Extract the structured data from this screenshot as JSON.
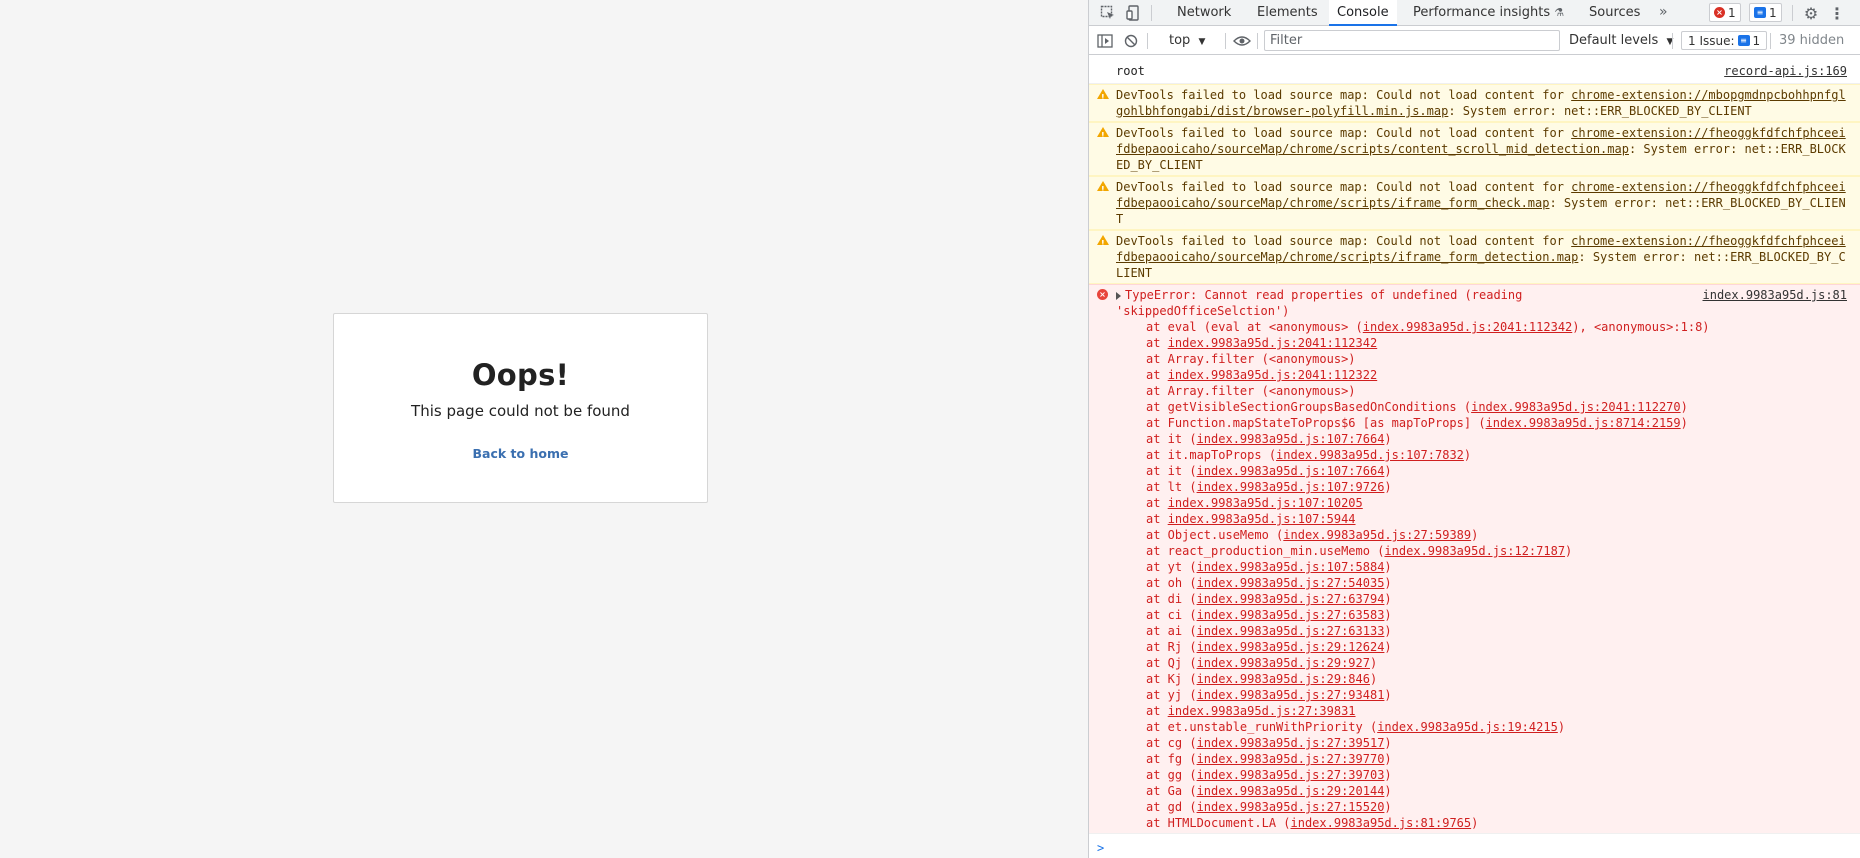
{
  "page": {
    "title": "Oops!",
    "subtitle": "This page could not be found",
    "back_link": "Back to home"
  },
  "devtools": {
    "tabs": [
      "Network",
      "Elements",
      "Console",
      "Performance insights",
      "Sources"
    ],
    "active_tab": "Console",
    "more_tabs_glyph": "»",
    "error_count": "1",
    "message_count": "1",
    "toolbar": {
      "context": "top",
      "filter_placeholder": "Filter",
      "levels": "Default levels",
      "issues_label": "1 Issue:",
      "issues_count": "1",
      "hidden": "39 hidden"
    },
    "log": {
      "text": "root",
      "source": "record-api.js:169"
    },
    "warnings": [
      {
        "prefix": "DevTools failed to load source map: Could not load content for ",
        "url": "chrome-extension://mbopgmdnpcbohhpnfglgohlbhfongabi/dist/browser-polyfill.min.js.map",
        "suffix": ": System error: net::ERR_BLOCKED_BY_CLIENT"
      },
      {
        "prefix": "DevTools failed to load source map: Could not load content for ",
        "url": "chrome-extension://fheoggkfdfchfphceeifdbepaooicaho/sourceMap/chrome/scripts/content_scroll_mid_detection.map",
        "suffix": ": System error: net::ERR_BLOCKED_BY_CLIENT"
      },
      {
        "prefix": "DevTools failed to load source map: Could not load content for ",
        "url": "chrome-extension://fheoggkfdfchfphceeifdbepaooicaho/sourceMap/chrome/scripts/iframe_form_check.map",
        "suffix": ": System error: net::ERR_BLOCKED_BY_CLIENT"
      },
      {
        "prefix": "DevTools failed to load source map: Could not load content for ",
        "url": "chrome-extension://fheoggkfdfchfphceeifdbepaooicaho/sourceMap/chrome/scripts/iframe_form_detection.map",
        "suffix": ": System error: net::ERR_BLOCKED_BY_CLIENT"
      }
    ],
    "error": {
      "message": "TypeError: Cannot read properties of undefined (reading 'skippedOfficeSelction')",
      "source": "index.9983a95d.js:81",
      "stack": [
        {
          "pre": "at eval (eval at <anonymous> (",
          "link": "index.9983a95d.js:2041:112342",
          "post": "), <anonymous>:1:8)"
        },
        {
          "pre": "at ",
          "link": "index.9983a95d.js:2041:112342",
          "post": ""
        },
        {
          "pre": "at Array.filter (<anonymous>)",
          "link": "",
          "post": ""
        },
        {
          "pre": "at ",
          "link": "index.9983a95d.js:2041:112322",
          "post": ""
        },
        {
          "pre": "at Array.filter (<anonymous>)",
          "link": "",
          "post": ""
        },
        {
          "pre": "at getVisibleSectionGroupsBasedOnConditions (",
          "link": "index.9983a95d.js:2041:112270",
          "post": ")"
        },
        {
          "pre": "at Function.mapStateToProps$6 [as mapToProps] (",
          "link": "index.9983a95d.js:8714:2159",
          "post": ")"
        },
        {
          "pre": "at it (",
          "link": "index.9983a95d.js:107:7664",
          "post": ")"
        },
        {
          "pre": "at it.mapToProps (",
          "link": "index.9983a95d.js:107:7832",
          "post": ")"
        },
        {
          "pre": "at it (",
          "link": "index.9983a95d.js:107:7664",
          "post": ")"
        },
        {
          "pre": "at lt (",
          "link": "index.9983a95d.js:107:9726",
          "post": ")"
        },
        {
          "pre": "at ",
          "link": "index.9983a95d.js:107:10205",
          "post": ""
        },
        {
          "pre": "at ",
          "link": "index.9983a95d.js:107:5944",
          "post": ""
        },
        {
          "pre": "at Object.useMemo (",
          "link": "index.9983a95d.js:27:59389",
          "post": ")"
        },
        {
          "pre": "at react_production_min.useMemo (",
          "link": "index.9983a95d.js:12:7187",
          "post": ")"
        },
        {
          "pre": "at yt (",
          "link": "index.9983a95d.js:107:5884",
          "post": ")"
        },
        {
          "pre": "at oh (",
          "link": "index.9983a95d.js:27:54035",
          "post": ")"
        },
        {
          "pre": "at di (",
          "link": "index.9983a95d.js:27:63794",
          "post": ")"
        },
        {
          "pre": "at ci (",
          "link": "index.9983a95d.js:27:63583",
          "post": ")"
        },
        {
          "pre": "at ai (",
          "link": "index.9983a95d.js:27:63133",
          "post": ")"
        },
        {
          "pre": "at Rj (",
          "link": "index.9983a95d.js:29:12624",
          "post": ")"
        },
        {
          "pre": "at Qj (",
          "link": "index.9983a95d.js:29:927",
          "post": ")"
        },
        {
          "pre": "at Kj (",
          "link": "index.9983a95d.js:29:846",
          "post": ")"
        },
        {
          "pre": "at yj (",
          "link": "index.9983a95d.js:27:93481",
          "post": ")"
        },
        {
          "pre": "at ",
          "link": "index.9983a95d.js:27:39831",
          "post": ""
        },
        {
          "pre": "at et.unstable_runWithPriority (",
          "link": "index.9983a95d.js:19:4215",
          "post": ")"
        },
        {
          "pre": "at cg (",
          "link": "index.9983a95d.js:27:39517",
          "post": ")"
        },
        {
          "pre": "at fg (",
          "link": "index.9983a95d.js:27:39770",
          "post": ")"
        },
        {
          "pre": "at gg (",
          "link": "index.9983a95d.js:27:39703",
          "post": ")"
        },
        {
          "pre": "at Ga (",
          "link": "index.9983a95d.js:29:20144",
          "post": ")"
        },
        {
          "pre": "at gd (",
          "link": "index.9983a95d.js:27:15520",
          "post": ")"
        },
        {
          "pre": "at HTMLDocument.LA (",
          "link": "index.9983a95d.js:81:9765",
          "post": ")"
        }
      ]
    },
    "prompt_glyph": ">"
  }
}
